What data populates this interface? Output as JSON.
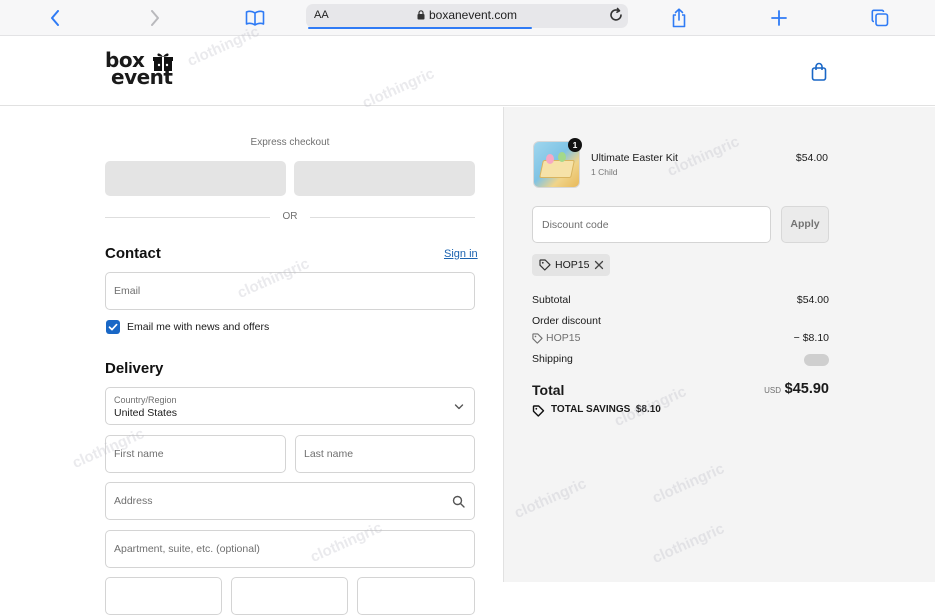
{
  "browser": {
    "aa_label": "AA",
    "url": "boxanevent.com"
  },
  "brand": {
    "logo_line1": "box",
    "logo_line2": "event"
  },
  "checkout": {
    "express_label": "Express checkout",
    "or_label": "OR",
    "contact_title": "Contact",
    "sign_in_label": "Sign in",
    "email_placeholder": "Email",
    "newsletter_label": "Email me with news and offers",
    "newsletter_checked": true,
    "delivery_title": "Delivery",
    "country_label": "Country/Region",
    "country_value": "United States",
    "first_name_placeholder": "First name",
    "last_name_placeholder": "Last name",
    "address_placeholder": "Address",
    "apartment_placeholder": "Apartment, suite, etc. (optional)"
  },
  "summary": {
    "item": {
      "name": "Ultimate Easter Kit",
      "variant": "1 Child",
      "price": "$54.00",
      "quantity": "1"
    },
    "discount_placeholder": "Discount code",
    "apply_label": "Apply",
    "applied_code": "HOP15",
    "subtotal_label": "Subtotal",
    "subtotal_value": "$54.00",
    "order_discount_label": "Order discount",
    "order_discount_code": "HOP15",
    "order_discount_value": "− $8.10",
    "shipping_label": "Shipping",
    "total_label": "Total",
    "currency": "USD",
    "total_value": "$45.90",
    "savings_label": "TOTAL SAVINGS",
    "savings_value": "$8.10"
  },
  "watermark": "clothingric",
  "colors": {
    "accent": "#1967c6",
    "link": "#1b63b0",
    "summary_bg": "#f4f4f4"
  }
}
